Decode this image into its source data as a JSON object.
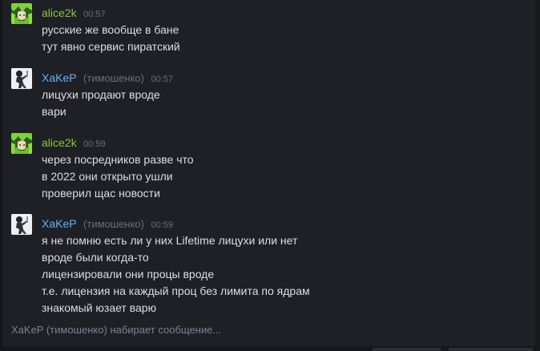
{
  "messages": [
    {
      "author": "alice2k",
      "nickname": "",
      "time": "00:57",
      "avatar": "green-anime-avatar",
      "lines": [
        "русские же вообще в бане",
        "тут явно сервис пиратский"
      ]
    },
    {
      "author": "XaKeP",
      "nickname": "(тимошенко)",
      "time": "00:57",
      "avatar": "white-figure-avatar",
      "lines": [
        "лицухи продают вроде",
        "вари"
      ]
    },
    {
      "author": "alice2k",
      "nickname": "",
      "time": "00:59",
      "avatar": "green-anime-avatar",
      "lines": [
        "через посредников разве что",
        "в 2022 они открыто ушли",
        "проверил щас новости"
      ]
    },
    {
      "author": "XaKeP",
      "nickname": "(тимошенко)",
      "time": "00:59",
      "avatar": "white-figure-avatar",
      "lines": [
        "я не помню есть ли у них Lifetime лицухи или нет",
        "вроде были когда-то",
        "лицензировали они процы вроде",
        "т.е. лицензия на каждый проц без лимита по ядрам",
        "знакомый юзает варю"
      ]
    }
  ],
  "typing_indicator": "XaKeP (тимошенко) набирает сообщение...",
  "colors": {
    "background": "#1e2025",
    "alice_name": "#8bc53f",
    "xaker_name": "#62b3f0",
    "message_text": "#dcdedf",
    "meta_text": "#6b6f77"
  }
}
